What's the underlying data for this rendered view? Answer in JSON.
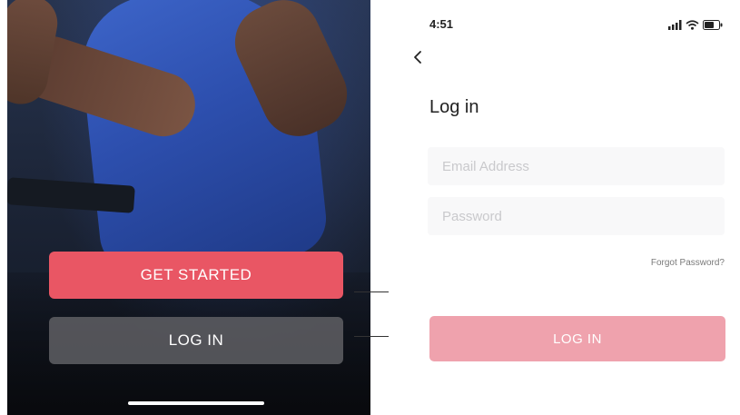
{
  "welcome_screen": {
    "get_started_label": "GET STARTED",
    "login_label": "LOG IN",
    "get_started_color": "#e95664"
  },
  "login_screen": {
    "status_bar": {
      "time": "4:51",
      "icons": [
        "signal-icon",
        "wifi-icon",
        "battery-icon"
      ]
    },
    "back_icon": "chevron-left-icon",
    "title": "Log in",
    "email_placeholder": "Email Address",
    "password_placeholder": "Password",
    "forgot_password": "Forgot Password?",
    "login_label": "LOG IN",
    "login_button_color": "#efa2ad"
  }
}
